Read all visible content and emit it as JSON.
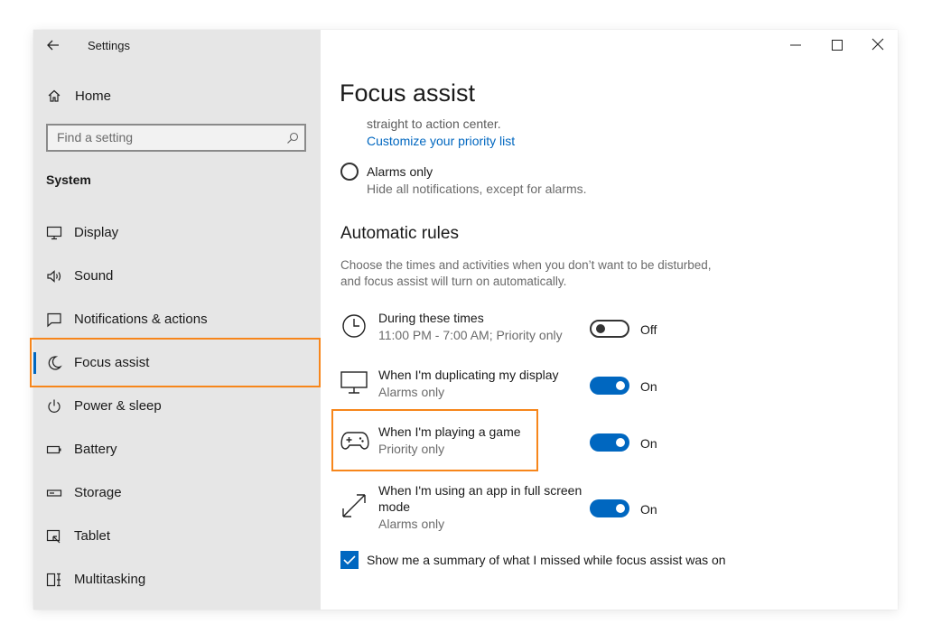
{
  "window": {
    "title": "Settings",
    "controls": {
      "minimize": "minimize",
      "maximize": "maximize",
      "close": "close"
    }
  },
  "sidebar": {
    "home_label": "Home",
    "search_placeholder": "Find a setting",
    "section_title": "System",
    "items": [
      {
        "label": "Display",
        "icon": "display-icon"
      },
      {
        "label": "Sound",
        "icon": "sound-icon"
      },
      {
        "label": "Notifications & actions",
        "icon": "notifications-icon"
      },
      {
        "label": "Focus assist",
        "icon": "moon-icon",
        "selected": true
      },
      {
        "label": "Power & sleep",
        "icon": "power-icon"
      },
      {
        "label": "Battery",
        "icon": "battery-icon"
      },
      {
        "label": "Storage",
        "icon": "storage-icon"
      },
      {
        "label": "Tablet",
        "icon": "tablet-icon"
      },
      {
        "label": "Multitasking",
        "icon": "multitasking-icon"
      }
    ]
  },
  "main": {
    "title": "Focus assist",
    "priority_desc_tail": "straight to action center.",
    "customize_link": "Customize your priority list",
    "alarms_only": {
      "label": "Alarms only",
      "description": "Hide all notifications, except for alarms.",
      "selected": false
    },
    "rules_heading": "Automatic rules",
    "rules_desc_line1": "Choose the times and activities when you don’t want to be disturbed,",
    "rules_desc_line2": "and focus assist will turn on automatically.",
    "rules": [
      {
        "icon": "clock-icon",
        "title": "During these times",
        "subtitle": "11:00 PM - 7:00 AM; Priority only",
        "state": "Off",
        "on": false
      },
      {
        "icon": "monitor-icon",
        "title": "When I'm duplicating my display",
        "subtitle": "Alarms only",
        "state": "On",
        "on": true
      },
      {
        "icon": "gamepad-icon",
        "title": "When I'm playing a game",
        "subtitle": "Priority only",
        "state": "On",
        "on": true
      },
      {
        "icon": "fullscreen-arrows-icon",
        "title_line1": "When I'm using an app in full screen",
        "title_line2": "mode",
        "subtitle": "Alarms only",
        "state": "On",
        "on": true
      }
    ],
    "summary_checkbox": {
      "label": "Show me a summary of what I missed while focus assist was on",
      "checked": true
    }
  },
  "colors": {
    "accent": "#0067c0",
    "highlight": "#f7861b",
    "sidebar_bg": "#e6e6e6"
  }
}
